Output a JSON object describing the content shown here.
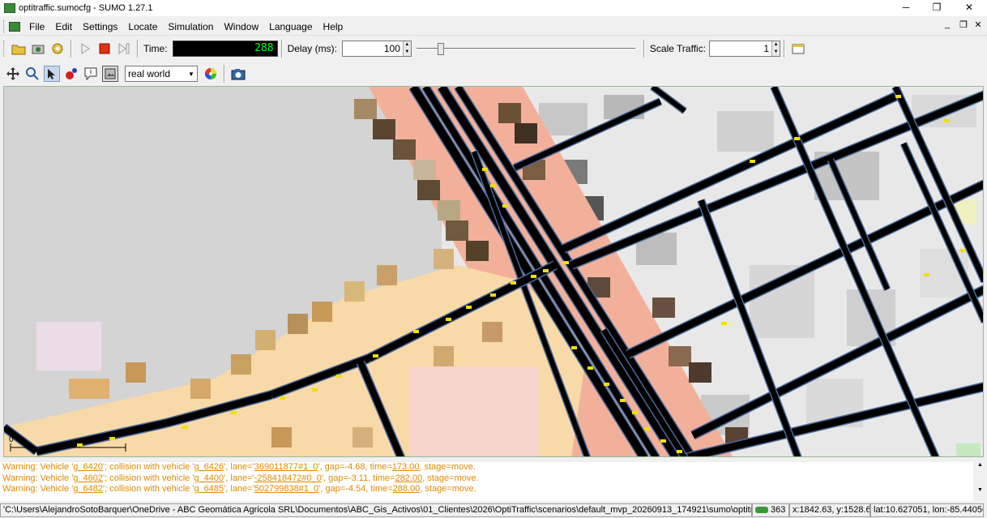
{
  "window": {
    "title": "optitraffic.sumocfg - SUMO 1.27.1",
    "controls": [
      "─",
      "❐",
      "✕"
    ]
  },
  "menu": {
    "items": [
      "File",
      "Edit",
      "Settings",
      "Locate",
      "Simulation",
      "Window",
      "Language",
      "Help"
    ],
    "mdi_controls": [
      "_",
      "❐",
      "✕"
    ]
  },
  "toolbar": {
    "time_label": "Time:",
    "time_value": "288",
    "delay_label": "Delay (ms):",
    "delay_value": "100",
    "scale_label": "Scale Traffic:",
    "scale_value": "1",
    "delay_slider_fraction": 0.1
  },
  "view_toolbar": {
    "scheme_value": "real world"
  },
  "canvas": {
    "scale_label": "0"
  },
  "messages": [
    {
      "pre": "Warning: Vehicle '",
      "veh": "g_6420",
      "mid": "'; collision with vehicle '",
      "veh2": "g_6426",
      "lane_pre": "', lane='",
      "lane": "369011877#1_0",
      "gap": "', gap=-4.68, time=",
      "time": "173.00",
      "post": ", stage=move."
    },
    {
      "pre": "Warning: Vehicle '",
      "veh": "g_4602",
      "mid": "'; collision with vehicle '",
      "veh2": "g_4400",
      "lane_pre": "', lane='",
      "lane": "-258418472#0_0",
      "gap": "', gap=-3.11, time=",
      "time": "282.00",
      "post": ", stage=move."
    },
    {
      "pre": "Warning: Vehicle '",
      "veh": "g_6482",
      "mid": "'; collision with vehicle '",
      "veh2": "g_6485",
      "lane_pre": "', lane='",
      "lane": "502799838#1_0",
      "gap": "', gap=-4.54, time=",
      "time": "288.00",
      "post": ", stage=move."
    }
  ],
  "statusbar": {
    "path": "'C:\\Users\\AlejandroSotoBarquer\\OneDrive - ABC Geomática Agricola SRL\\Documentos\\ABC_Gis_Activos\\01_Clientes\\2026\\OptiTraffic\\scenarios\\default_mvp_20260913_174921\\sumo\\optitraffic.su",
    "vehicles": "363",
    "xy": "x:1842.63, y:1528.67",
    "latlon": "lat:10.627051, lon:-85.440566"
  },
  "colors": {
    "road": "#000000",
    "lane_edge": "#4a6a9a",
    "vehicle": "#f0e000",
    "warning": "#e08a00"
  }
}
